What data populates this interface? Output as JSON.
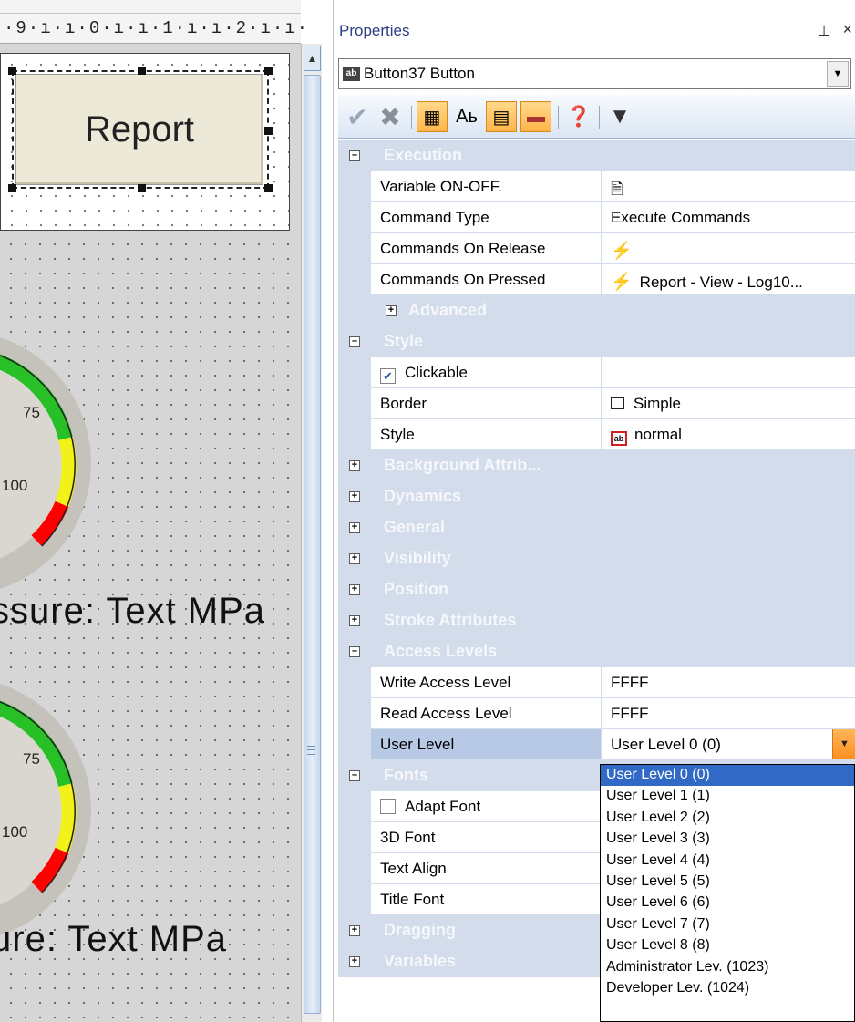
{
  "canvas": {
    "ruler_text": "·9·ı·ı·0·ı·ı·1·ı·ı·2·ı·ı·",
    "report_button_label": "Report",
    "gauge_ticks": [
      "75",
      "100"
    ],
    "pressure_text_1": "ssure:  Text  MPa",
    "pressure_text_2": "ure:   Text  MPa"
  },
  "properties": {
    "title": "Properties",
    "pin_icon": "pin-icon",
    "close_glyph": "×",
    "object_selector": "Button37 Button",
    "toolbar_icons": [
      "check-icon",
      "delete-icon",
      "categorized-icon",
      "alphabetical-icon",
      "properties-icon",
      "events-icon",
      "help-icon",
      "filter-icon"
    ],
    "rows": {
      "execution": "Execution",
      "variable_on_off": "Variable ON-OFF.",
      "command_type": "Command Type",
      "command_type_val": "Execute Commands",
      "commands_on_release": "Commands On Release",
      "commands_on_pressed": "Commands On Pressed",
      "commands_on_pressed_val": "Report - View - Log10...",
      "advanced": "Advanced",
      "style_cat": "Style",
      "clickable": "Clickable",
      "border": "Border",
      "border_val": "Simple",
      "style": "Style",
      "style_val": "normal",
      "background": "Background Attrib...",
      "dynamics": "Dynamics",
      "general": "General",
      "visibility": "Visibility",
      "position": "Position",
      "stroke": "Stroke Attributes",
      "access_levels": "Access Levels",
      "write_access": "Write Access Level",
      "write_access_val": "FFFF",
      "read_access": "Read Access Level",
      "read_access_val": "FFFF",
      "user_level": "User Level",
      "user_level_val": "User Level 0 (0)",
      "fonts": "Fonts",
      "adapt_font": "Adapt Font",
      "font_3d": "3D Font",
      "text_align": "Text Align",
      "title_font": "Title Font",
      "dragging": "Dragging",
      "variables": "Variables"
    },
    "dropdown_options": [
      "User Level 0 (0)",
      "User Level 1 (1)",
      "User Level 2 (2)",
      "User Level 3 (3)",
      "User Level 4 (4)",
      "User Level 5 (5)",
      "User Level 6 (6)",
      "User Level 7 (7)",
      "User Level 8 (8)",
      "Administrator Lev. (1023)",
      "Developer Lev. (1024)"
    ],
    "selected_option_index": 0,
    "colors": {
      "category_bg": "#d3dcea",
      "highlight": "#3169c6",
      "dropdown_button": "#ff9a2e",
      "title_text": "#2d3e82"
    }
  }
}
